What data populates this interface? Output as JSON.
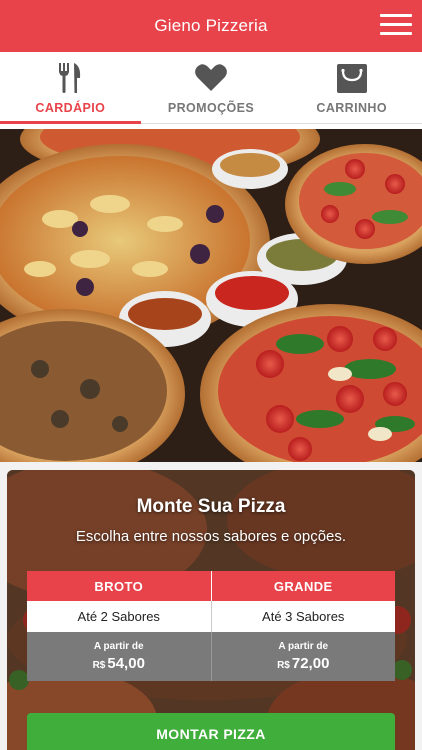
{
  "header": {
    "title": "Gieno Pizzeria",
    "accent_color": "#e8434a"
  },
  "tabs": [
    {
      "label": "CARDÁPIO",
      "icon": "fork-knife-icon",
      "active": true
    },
    {
      "label": "PROMOÇÕES",
      "icon": "heart-icon",
      "active": false
    },
    {
      "label": "CARRINHO",
      "icon": "shopping-bag-icon",
      "active": false
    }
  ],
  "hero": {
    "image": "pizzas-photo"
  },
  "builder": {
    "title": "Monte Sua Pizza",
    "subtitle": "Escolha entre nossos sabores e opções.",
    "sizes": [
      {
        "name": "BROTO",
        "flavors": "Até 2 Sabores",
        "price_from": "A partir de",
        "currency": "R$",
        "price": "54,00"
      },
      {
        "name": "GRANDE",
        "flavors": "Até 3 Sabores",
        "price_from": "A partir de",
        "currency": "R$",
        "price": "72,00"
      }
    ],
    "button_label": "MONTAR PIZZA",
    "button_color": "#3fae3a"
  }
}
